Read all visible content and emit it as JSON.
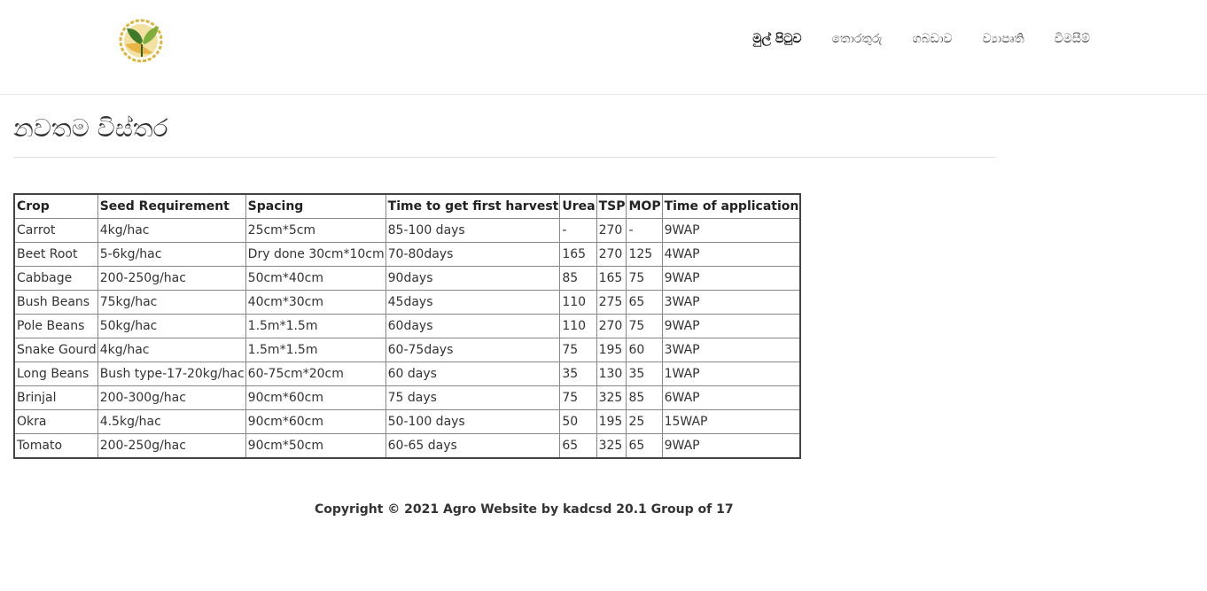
{
  "header": {
    "logo_icon": "leaf-logo-icon",
    "nav": [
      {
        "label": "මුල් පිටුව",
        "active": true
      },
      {
        "label": "තොරතුරු",
        "active": false
      },
      {
        "label": "ගබඩාව",
        "active": false
      },
      {
        "label": "ව්‍යාපෘති",
        "active": false
      },
      {
        "label": "විමසීම්",
        "active": false
      }
    ]
  },
  "main": {
    "title": "නවතම විස්තර",
    "table": {
      "headers": [
        "Crop",
        "Seed Requirement",
        "Spacing",
        "Time to get first harvest",
        "Urea",
        "TSP",
        "MOP",
        "Time of application"
      ],
      "rows": [
        [
          "Carrot",
          "4kg/hac",
          "25cm*5cm",
          "85-100 days",
          "-",
          "270",
          "-",
          "9WAP"
        ],
        [
          "Beet Root",
          "5-6kg/hac",
          "Dry done 30cm*10cm",
          "70-80days",
          "165",
          "270",
          "125",
          "4WAP"
        ],
        [
          "Cabbage",
          "200-250g/hac",
          "50cm*40cm",
          "90days",
          "85",
          "165",
          "75",
          "9WAP"
        ],
        [
          "Bush Beans",
          "75kg/hac",
          "40cm*30cm",
          "45days",
          "110",
          "275",
          "65",
          "3WAP"
        ],
        [
          "Pole Beans",
          "50kg/hac",
          "1.5m*1.5m",
          "60days",
          "110",
          "270",
          "75",
          "9WAP"
        ],
        [
          "Snake Gourd",
          "4kg/hac",
          "1.5m*1.5m",
          "60-75days",
          "75",
          "195",
          "60",
          "3WAP"
        ],
        [
          "Long Beans",
          "Bush type-17-20kg/hac",
          "60-75cm*20cm",
          "60 days",
          "35",
          "130",
          "35",
          "1WAP"
        ],
        [
          "Brinjal",
          "200-300g/hac",
          "90cm*60cm",
          "75 days",
          "75",
          "325",
          "85",
          "6WAP"
        ],
        [
          "Okra",
          "4.5kg/hac",
          "90cm*60cm",
          "50-100 days",
          "50",
          "195",
          "25",
          "15WAP"
        ],
        [
          "Tomato",
          "200-250g/hac",
          "90cm*50cm",
          "60-65 days",
          "65",
          "325",
          "65",
          "9WAP"
        ]
      ]
    }
  },
  "footer": {
    "text": "Copyright © 2021 Agro Website by kadcsd 20.1 Group of 17"
  },
  "colors": {
    "logo_green": "#6a9a2a",
    "logo_yellow": "#e0b33a",
    "logo_dark": "#2f5f1f"
  }
}
